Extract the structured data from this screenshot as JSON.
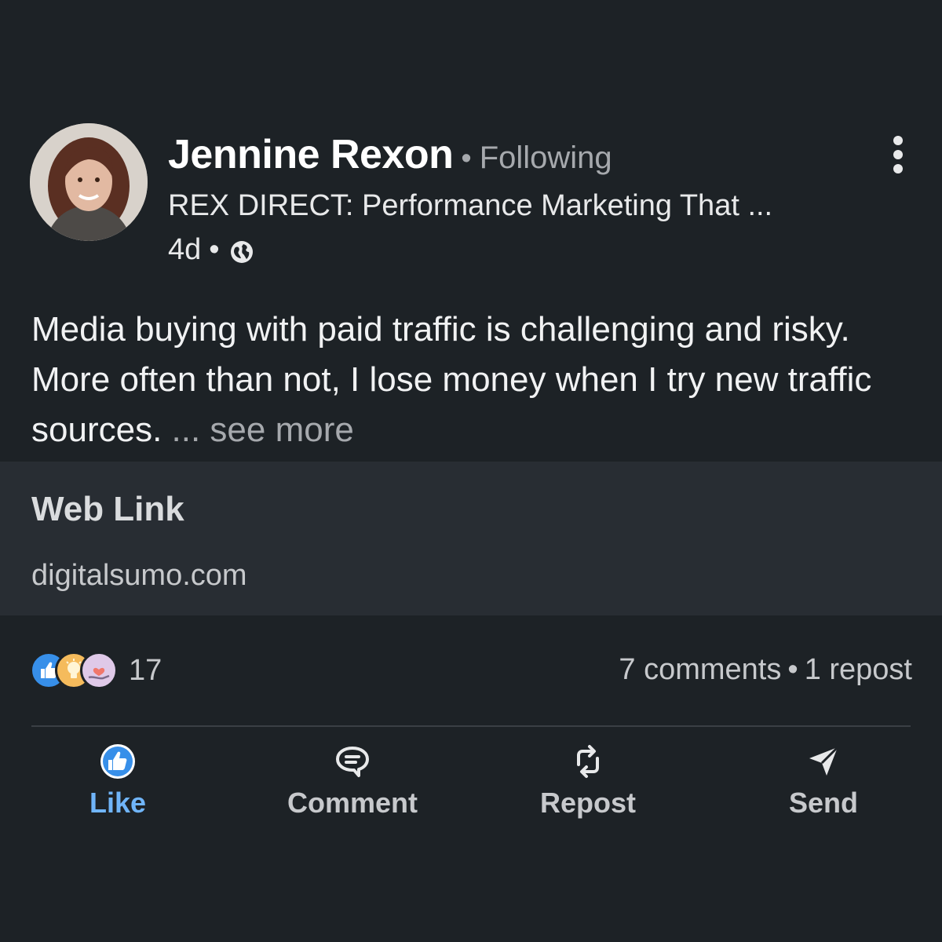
{
  "post": {
    "author": {
      "name": "Jennine Rexon",
      "separator": "•",
      "follow_status": "Following",
      "headline": "REX DIRECT: Performance Marketing That ...",
      "time_ago": "4d",
      "meta_separator": "•",
      "visibility_icon": "globe-icon",
      "avatar_icon": "profile-photo"
    },
    "body": {
      "text": "Media buying with paid traffic is challenging and risky. More often than not, I lose money when I try new traffic sources. ",
      "see_more": "... see more"
    },
    "link_card": {
      "title": "Web Link",
      "domain": "digitalsumo.com"
    },
    "social": {
      "reaction_icons": [
        "like-reaction-icon",
        "insightful-reaction-icon",
        "support-reaction-icon"
      ],
      "reaction_count": "17",
      "comments": "7 comments",
      "separator": "•",
      "reposts": "1 repost"
    },
    "actions": {
      "like": "Like",
      "comment": "Comment",
      "repost": "Repost",
      "send": "Send"
    }
  },
  "colors": {
    "background": "#1d2226",
    "card_background": "#282d33",
    "like_accent": "#70b5f9",
    "muted_text": "#a6a9ad"
  }
}
